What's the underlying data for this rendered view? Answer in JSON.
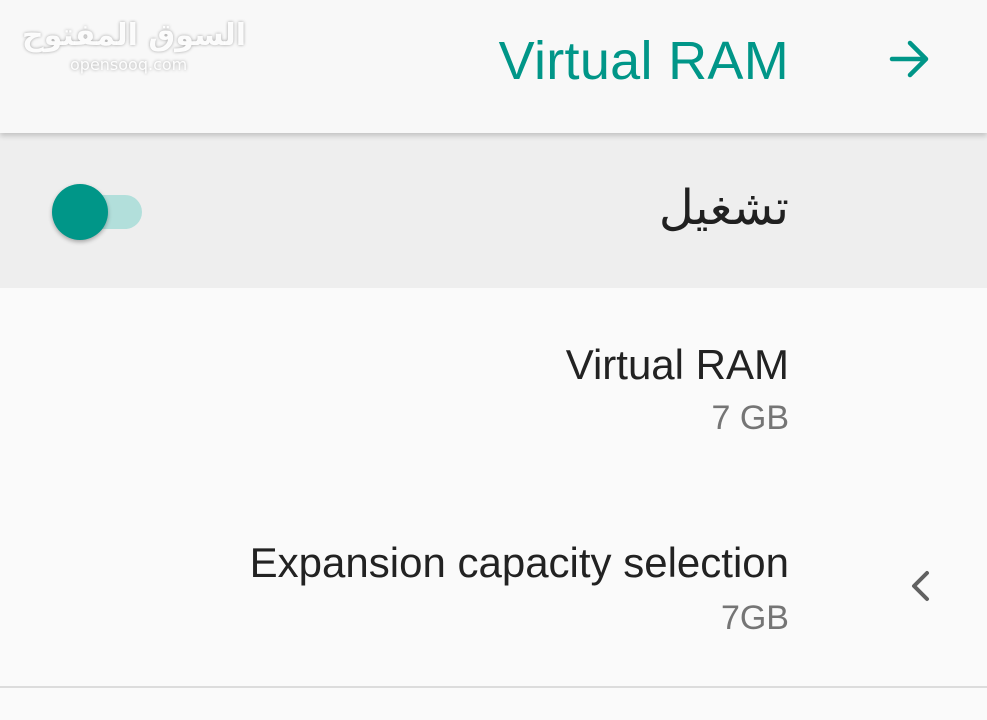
{
  "colors": {
    "accent": "#009688",
    "accent_light": "#b2dfdb",
    "background": "#fafafa",
    "switch_row_background": "#eeeeee",
    "primary_text": "#222222",
    "secondary_text": "#757575"
  },
  "appbar": {
    "title": "Virtual RAM",
    "back_icon": "arrow-right-icon"
  },
  "watermark": {
    "arabic": "السوق المفتوح",
    "latin": "opensooq.com"
  },
  "master_switch": {
    "label": "تشغيل",
    "state": "on"
  },
  "preferences": [
    {
      "title": "Virtual RAM",
      "summary": "7 GB"
    },
    {
      "title": "Expansion capacity selection",
      "summary": "7GB",
      "icon": "chevron-left-icon"
    }
  ]
}
